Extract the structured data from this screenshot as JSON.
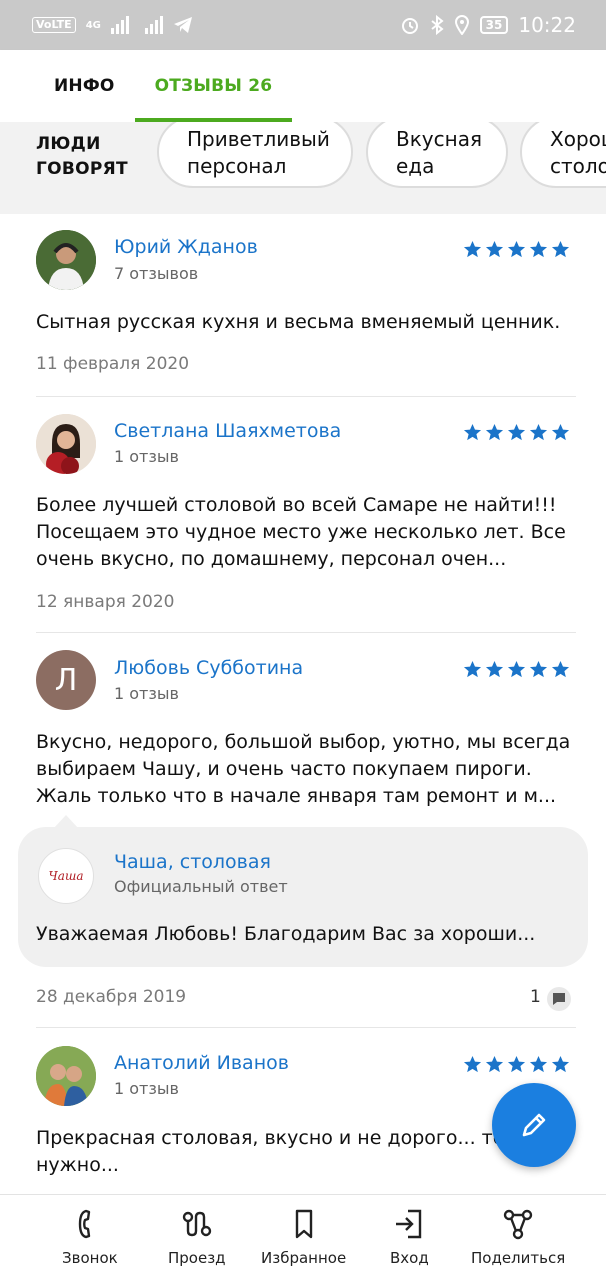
{
  "status_bar": {
    "left_badges": [
      "VoLTE",
      "4G"
    ],
    "battery": "35",
    "time": "10:22"
  },
  "tabs": [
    {
      "label": "ИНФО",
      "active": false
    },
    {
      "label": "ОТЗЫВЫ 26",
      "active": true
    }
  ],
  "people_say": {
    "label_line1": "ЛЮДИ",
    "label_line2": "ГОВОРЯТ",
    "chips": [
      {
        "line1": "Приветливый",
        "line2": "персонал"
      },
      {
        "line1": "Вкусная",
        "line2": "еда"
      },
      {
        "line1": "Хорошая",
        "line2": "столовая"
      }
    ]
  },
  "reviews": [
    {
      "name": "Юрий Жданов",
      "count": "7 отзывов",
      "rating": 5,
      "text_lines": [
        "Сытная русская кухня и весьма вменяемый ценник."
      ],
      "date": "11 февраля 2020"
    },
    {
      "name": "Светлана Шаяхметова",
      "count": "1 отзыв",
      "rating": 5,
      "text_lines": [
        "Более лучшей столовой во всей Самаре не найти!!!",
        "Посещаем это чудное место уже несколько лет. Все",
        "очень вкусно, по домашнему, персонал очен..."
      ],
      "date": "12 января 2020"
    },
    {
      "name": "Любовь Субботина",
      "count": "1 отзыв",
      "avatar_letter": "Л",
      "rating": 5,
      "text_lines": [
        "Вкусно, недорого, большой выбор, уютно, мы всегда",
        "выбираем Чашу, и очень часто покупаем пироги.",
        "Жаль только что в начале января там ремонт и м..."
      ],
      "date": "28 декабря 2019",
      "comments": "1",
      "reply": {
        "name": "Чаша, столовая",
        "subtitle": "Официальный ответ",
        "text": "Уважаемая Любовь! Благодарим Вас за хороши...",
        "logo_text": "Чаша"
      }
    },
    {
      "name": "Анатолий Иванов",
      "count": "1 отзыв",
      "rating": 5,
      "text_lines": [
        "Прекрасная столовая, вкусно и не дорого... то что",
        "нужно..."
      ]
    }
  ],
  "bottom_nav": [
    {
      "label": "Звонок",
      "icon": "phone-icon"
    },
    {
      "label": "Проезд",
      "icon": "route-icon"
    },
    {
      "label": "Избранное",
      "icon": "bookmark-icon"
    },
    {
      "label": "Вход",
      "icon": "login-icon"
    },
    {
      "label": "Поделиться",
      "icon": "share-icon"
    }
  ],
  "colors": {
    "accent_green": "#4caa1f",
    "link_blue": "#1b74c9",
    "fab_blue": "#1b7fe0"
  }
}
